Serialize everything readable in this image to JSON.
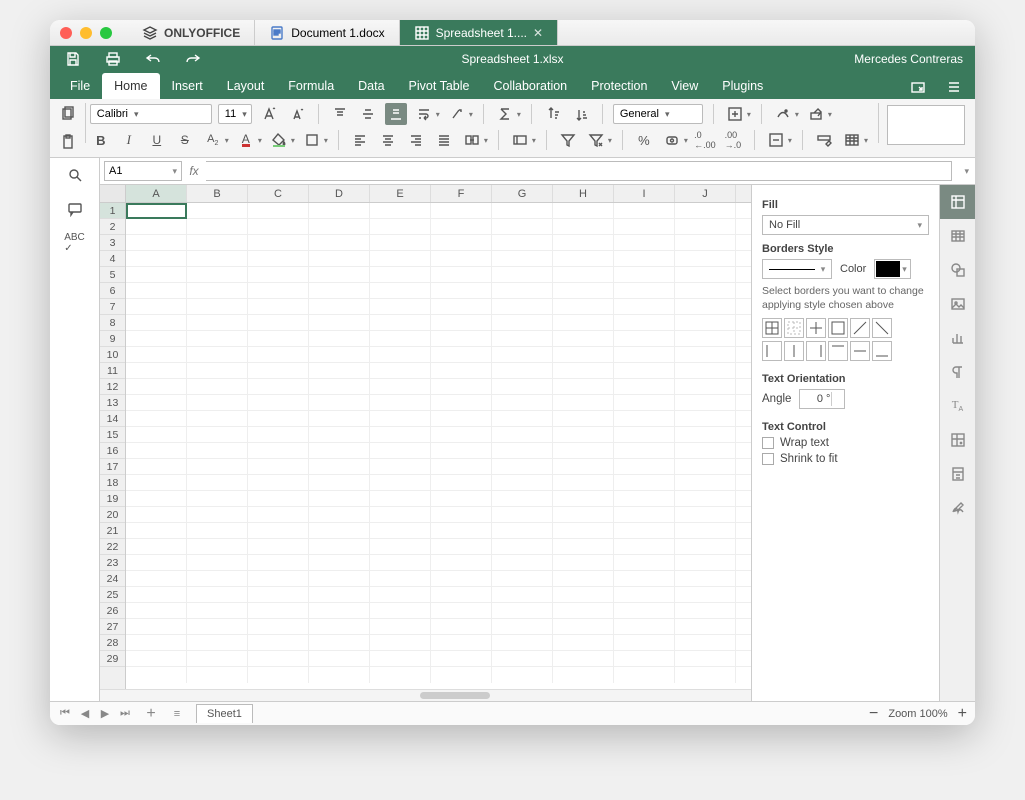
{
  "brand": "ONLYOFFICE",
  "document_tabs": [
    {
      "label": "Document 1.docx",
      "active": false
    },
    {
      "label": "Spreadsheet 1....",
      "active": true
    }
  ],
  "window_title": "Spreadsheet 1.xlsx",
  "user_name": "Mercedes Contreras",
  "menu": {
    "items": [
      "File",
      "Home",
      "Insert",
      "Layout",
      "Formula",
      "Data",
      "Pivot Table",
      "Collaboration",
      "Protection",
      "View",
      "Plugins"
    ],
    "active_index": 1
  },
  "toolbar": {
    "font_name": "Calibri",
    "font_size": "11",
    "number_format": "General"
  },
  "name_box": "A1",
  "formula_bar": "",
  "columns": [
    "A",
    "B",
    "C",
    "D",
    "E",
    "F",
    "G",
    "H",
    "I",
    "J"
  ],
  "row_count": 29,
  "selected_cell": {
    "row": 1,
    "col": "A"
  },
  "right_panel": {
    "fill_label": "Fill",
    "fill_value": "No Fill",
    "borders_label": "Borders Style",
    "color_label": "Color",
    "color_value": "#000000",
    "borders_desc": "Select borders you want to change applying style chosen above",
    "orient_label": "Text Orientation",
    "angle_label": "Angle",
    "angle_value": "0 °",
    "control_label": "Text Control",
    "wrap_label": "Wrap text",
    "shrink_label": "Shrink to fit"
  },
  "sheet_tabs": [
    "Sheet1"
  ],
  "zoom_label": "Zoom 100%"
}
